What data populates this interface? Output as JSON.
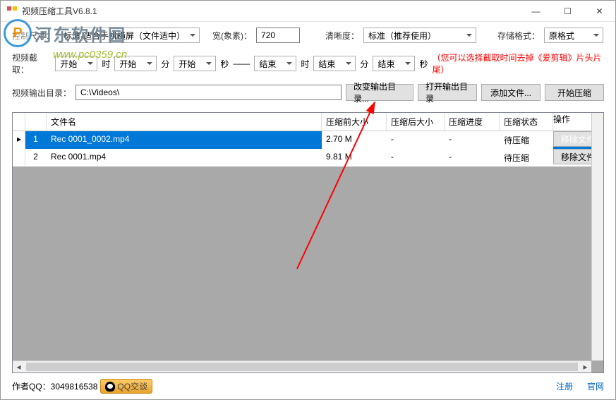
{
  "window": {
    "title": "视频压缩工具V6.8.1"
  },
  "settings": {
    "sizeLabel": "控制尺寸：",
    "sizeValue": "标清-适合手机横屏（文件适中）",
    "widthLabel": "宽(象素)：",
    "widthValue": "720",
    "clarityLabel": "清晰度：",
    "clarityValue": "标准（推荐使用）",
    "formatLabel": "存储格式：",
    "formatValue": "原格式"
  },
  "clip": {
    "label": "视频截取：",
    "startVal": "开始",
    "hourUnit": "时",
    "minUnit": "分",
    "secUnit": "秒",
    "sep": "——",
    "endVal": "结束",
    "hint": "（您可以选择截取时间去掉《爱剪辑》片头片尾）"
  },
  "output": {
    "label": "视频输出目录：",
    "path": "C:\\Videos\\",
    "changeBtn": "改变输出目录...",
    "openBtn": "打开输出目录",
    "addBtn": "添加文件...",
    "startBtn": "开始压缩"
  },
  "table": {
    "headers": {
      "name": "文件名",
      "before": "压缩前大小",
      "after": "压缩后大小",
      "progress": "压缩进度",
      "status": "压缩状态",
      "op": "操作"
    },
    "rows": [
      {
        "idx": "1",
        "name": "Rec 0001_0002.mp4",
        "before": "2.70 M",
        "after": "-",
        "progress": "-",
        "status": "待压缩",
        "opBtn": "移除文件",
        "selected": true
      },
      {
        "idx": "2",
        "name": "Rec 0001.mp4",
        "before": "9.81 M",
        "after": "-",
        "progress": "-",
        "status": "待压缩",
        "opBtn": "移除文件",
        "selected": false
      }
    ]
  },
  "footer": {
    "author": "作者QQ：3049816538",
    "qqBtn": "QQ交谈",
    "register": "注册",
    "website": "官网"
  },
  "watermark": {
    "logoLetter": "P",
    "cn": "河东软件园",
    "en": "www.pc0359.cn"
  }
}
